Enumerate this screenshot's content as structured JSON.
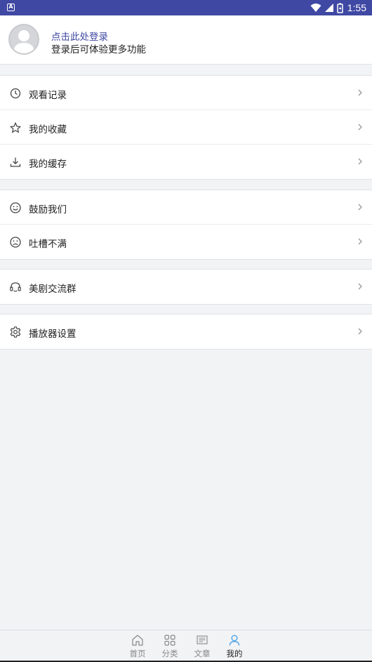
{
  "status_bar": {
    "time": "1:55"
  },
  "login": {
    "title": "点击此处登录",
    "subtitle": "登录后可体验更多功能"
  },
  "menu_groups": [
    {
      "items": [
        {
          "label": "观看记录",
          "icon": "clock-icon"
        },
        {
          "label": "我的收藏",
          "icon": "star-icon"
        },
        {
          "label": "我的缓存",
          "icon": "download-icon"
        }
      ]
    },
    {
      "items": [
        {
          "label": "鼓励我们",
          "icon": "smile-icon"
        },
        {
          "label": "吐槽不满",
          "icon": "frown-icon"
        }
      ]
    },
    {
      "items": [
        {
          "label": "美剧交流群",
          "icon": "headset-icon"
        }
      ]
    },
    {
      "items": [
        {
          "label": "播放器设置",
          "icon": "gear-icon"
        }
      ]
    }
  ],
  "tabs": [
    {
      "label": "首页",
      "icon": "home-icon",
      "active": false
    },
    {
      "label": "分类",
      "icon": "grid-icon",
      "active": false
    },
    {
      "label": "文章",
      "icon": "article-icon",
      "active": false
    },
    {
      "label": "我的",
      "icon": "user-icon",
      "active": true
    }
  ],
  "colors": {
    "brand": "#3f48a3",
    "active_tab_icon": "#4aa3e8",
    "background": "#f2f3f5"
  }
}
